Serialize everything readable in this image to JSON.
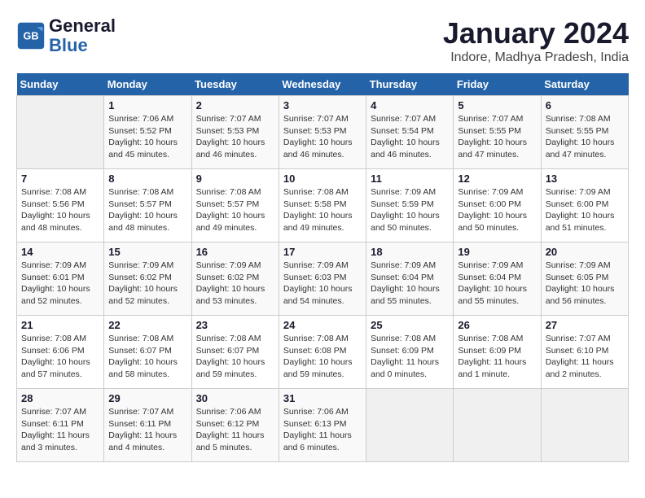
{
  "logo": {
    "line1": "General",
    "line2": "Blue"
  },
  "title": "January 2024",
  "subtitle": "Indore, Madhya Pradesh, India",
  "weekdays": [
    "Sunday",
    "Monday",
    "Tuesday",
    "Wednesday",
    "Thursday",
    "Friday",
    "Saturday"
  ],
  "weeks": [
    [
      {
        "day": "",
        "info": ""
      },
      {
        "day": "1",
        "info": "Sunrise: 7:06 AM\nSunset: 5:52 PM\nDaylight: 10 hours\nand 45 minutes."
      },
      {
        "day": "2",
        "info": "Sunrise: 7:07 AM\nSunset: 5:53 PM\nDaylight: 10 hours\nand 46 minutes."
      },
      {
        "day": "3",
        "info": "Sunrise: 7:07 AM\nSunset: 5:53 PM\nDaylight: 10 hours\nand 46 minutes."
      },
      {
        "day": "4",
        "info": "Sunrise: 7:07 AM\nSunset: 5:54 PM\nDaylight: 10 hours\nand 46 minutes."
      },
      {
        "day": "5",
        "info": "Sunrise: 7:07 AM\nSunset: 5:55 PM\nDaylight: 10 hours\nand 47 minutes."
      },
      {
        "day": "6",
        "info": "Sunrise: 7:08 AM\nSunset: 5:55 PM\nDaylight: 10 hours\nand 47 minutes."
      }
    ],
    [
      {
        "day": "7",
        "info": "Sunrise: 7:08 AM\nSunset: 5:56 PM\nDaylight: 10 hours\nand 48 minutes."
      },
      {
        "day": "8",
        "info": "Sunrise: 7:08 AM\nSunset: 5:57 PM\nDaylight: 10 hours\nand 48 minutes."
      },
      {
        "day": "9",
        "info": "Sunrise: 7:08 AM\nSunset: 5:57 PM\nDaylight: 10 hours\nand 49 minutes."
      },
      {
        "day": "10",
        "info": "Sunrise: 7:08 AM\nSunset: 5:58 PM\nDaylight: 10 hours\nand 49 minutes."
      },
      {
        "day": "11",
        "info": "Sunrise: 7:09 AM\nSunset: 5:59 PM\nDaylight: 10 hours\nand 50 minutes."
      },
      {
        "day": "12",
        "info": "Sunrise: 7:09 AM\nSunset: 6:00 PM\nDaylight: 10 hours\nand 50 minutes."
      },
      {
        "day": "13",
        "info": "Sunrise: 7:09 AM\nSunset: 6:00 PM\nDaylight: 10 hours\nand 51 minutes."
      }
    ],
    [
      {
        "day": "14",
        "info": "Sunrise: 7:09 AM\nSunset: 6:01 PM\nDaylight: 10 hours\nand 52 minutes."
      },
      {
        "day": "15",
        "info": "Sunrise: 7:09 AM\nSunset: 6:02 PM\nDaylight: 10 hours\nand 52 minutes."
      },
      {
        "day": "16",
        "info": "Sunrise: 7:09 AM\nSunset: 6:02 PM\nDaylight: 10 hours\nand 53 minutes."
      },
      {
        "day": "17",
        "info": "Sunrise: 7:09 AM\nSunset: 6:03 PM\nDaylight: 10 hours\nand 54 minutes."
      },
      {
        "day": "18",
        "info": "Sunrise: 7:09 AM\nSunset: 6:04 PM\nDaylight: 10 hours\nand 55 minutes."
      },
      {
        "day": "19",
        "info": "Sunrise: 7:09 AM\nSunset: 6:04 PM\nDaylight: 10 hours\nand 55 minutes."
      },
      {
        "day": "20",
        "info": "Sunrise: 7:09 AM\nSunset: 6:05 PM\nDaylight: 10 hours\nand 56 minutes."
      }
    ],
    [
      {
        "day": "21",
        "info": "Sunrise: 7:08 AM\nSunset: 6:06 PM\nDaylight: 10 hours\nand 57 minutes."
      },
      {
        "day": "22",
        "info": "Sunrise: 7:08 AM\nSunset: 6:07 PM\nDaylight: 10 hours\nand 58 minutes."
      },
      {
        "day": "23",
        "info": "Sunrise: 7:08 AM\nSunset: 6:07 PM\nDaylight: 10 hours\nand 59 minutes."
      },
      {
        "day": "24",
        "info": "Sunrise: 7:08 AM\nSunset: 6:08 PM\nDaylight: 10 hours\nand 59 minutes."
      },
      {
        "day": "25",
        "info": "Sunrise: 7:08 AM\nSunset: 6:09 PM\nDaylight: 11 hours\nand 0 minutes."
      },
      {
        "day": "26",
        "info": "Sunrise: 7:08 AM\nSunset: 6:09 PM\nDaylight: 11 hours\nand 1 minute."
      },
      {
        "day": "27",
        "info": "Sunrise: 7:07 AM\nSunset: 6:10 PM\nDaylight: 11 hours\nand 2 minutes."
      }
    ],
    [
      {
        "day": "28",
        "info": "Sunrise: 7:07 AM\nSunset: 6:11 PM\nDaylight: 11 hours\nand 3 minutes."
      },
      {
        "day": "29",
        "info": "Sunrise: 7:07 AM\nSunset: 6:11 PM\nDaylight: 11 hours\nand 4 minutes."
      },
      {
        "day": "30",
        "info": "Sunrise: 7:06 AM\nSunset: 6:12 PM\nDaylight: 11 hours\nand 5 minutes."
      },
      {
        "day": "31",
        "info": "Sunrise: 7:06 AM\nSunset: 6:13 PM\nDaylight: 11 hours\nand 6 minutes."
      },
      {
        "day": "",
        "info": ""
      },
      {
        "day": "",
        "info": ""
      },
      {
        "day": "",
        "info": ""
      }
    ]
  ]
}
